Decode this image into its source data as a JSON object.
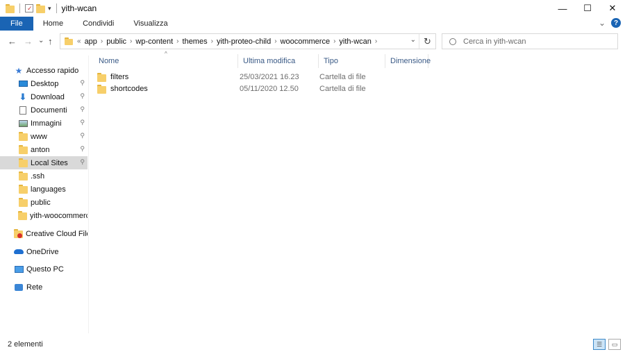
{
  "window": {
    "title": "yith-wcan",
    "minimize": "—",
    "maximize": "☐",
    "close": "✕"
  },
  "ribbon": {
    "tabs": [
      "File",
      "Home",
      "Condividi",
      "Visualizza"
    ],
    "expand": "⌄",
    "help": "?"
  },
  "nav": {
    "back": "←",
    "forward": "→",
    "recent": "⌄",
    "up": "↑"
  },
  "address": {
    "overflow": "«",
    "crumbs": [
      "app",
      "public",
      "wp-content",
      "themes",
      "yith-proteo-child",
      "woocommerce",
      "yith-wcan"
    ],
    "dropdown": "⌄",
    "refresh": "↻"
  },
  "search": {
    "placeholder": "Cerca in yith-wcan"
  },
  "sidebar": {
    "items": [
      {
        "label": "Accesso rapido",
        "icon": "star-icon",
        "pinned": false
      },
      {
        "label": "Desktop",
        "icon": "desktop-icon",
        "pinned": true
      },
      {
        "label": "Download",
        "icon": "download-icon",
        "pinned": true
      },
      {
        "label": "Documenti",
        "icon": "documents-icon",
        "pinned": true
      },
      {
        "label": "Immagini",
        "icon": "pictures-icon",
        "pinned": true
      },
      {
        "label": "www",
        "icon": "folder-icon",
        "pinned": true
      },
      {
        "label": "anton",
        "icon": "folder-icon",
        "pinned": true
      },
      {
        "label": "Local Sites",
        "icon": "folder-icon",
        "pinned": true,
        "selected": true
      },
      {
        "label": ".ssh",
        "icon": "folder-icon",
        "pinned": false
      },
      {
        "label": "languages",
        "icon": "folder-icon",
        "pinned": false
      },
      {
        "label": "public",
        "icon": "folder-icon",
        "pinned": false
      },
      {
        "label": "yith-woocommerce",
        "icon": "folder-icon",
        "pinned": false
      },
      {
        "label": "Creative Cloud Files",
        "icon": "creative-cloud-icon",
        "pinned": false
      },
      {
        "label": "OneDrive",
        "icon": "onedrive-icon",
        "pinned": false
      },
      {
        "label": "Questo PC",
        "icon": "pc-icon",
        "pinned": false
      },
      {
        "label": "Rete",
        "icon": "network-icon",
        "pinned": false
      }
    ],
    "pin_glyph": "📌"
  },
  "columns": [
    "Nome",
    "Ultima modifica",
    "Tipo",
    "Dimensione"
  ],
  "sort_glyph": "^",
  "files": [
    {
      "name": "filters",
      "modified": "25/03/2021 16.23",
      "type": "Cartella di file",
      "size": ""
    },
    {
      "name": "shortcodes",
      "modified": "05/11/2020 12.50",
      "type": "Cartella di file",
      "size": ""
    }
  ],
  "status": {
    "count": "2 elementi"
  },
  "colors": {
    "accent": "#1a64b4",
    "folder": "#f7cf6a",
    "selected_bg": "#d9d9d9"
  }
}
